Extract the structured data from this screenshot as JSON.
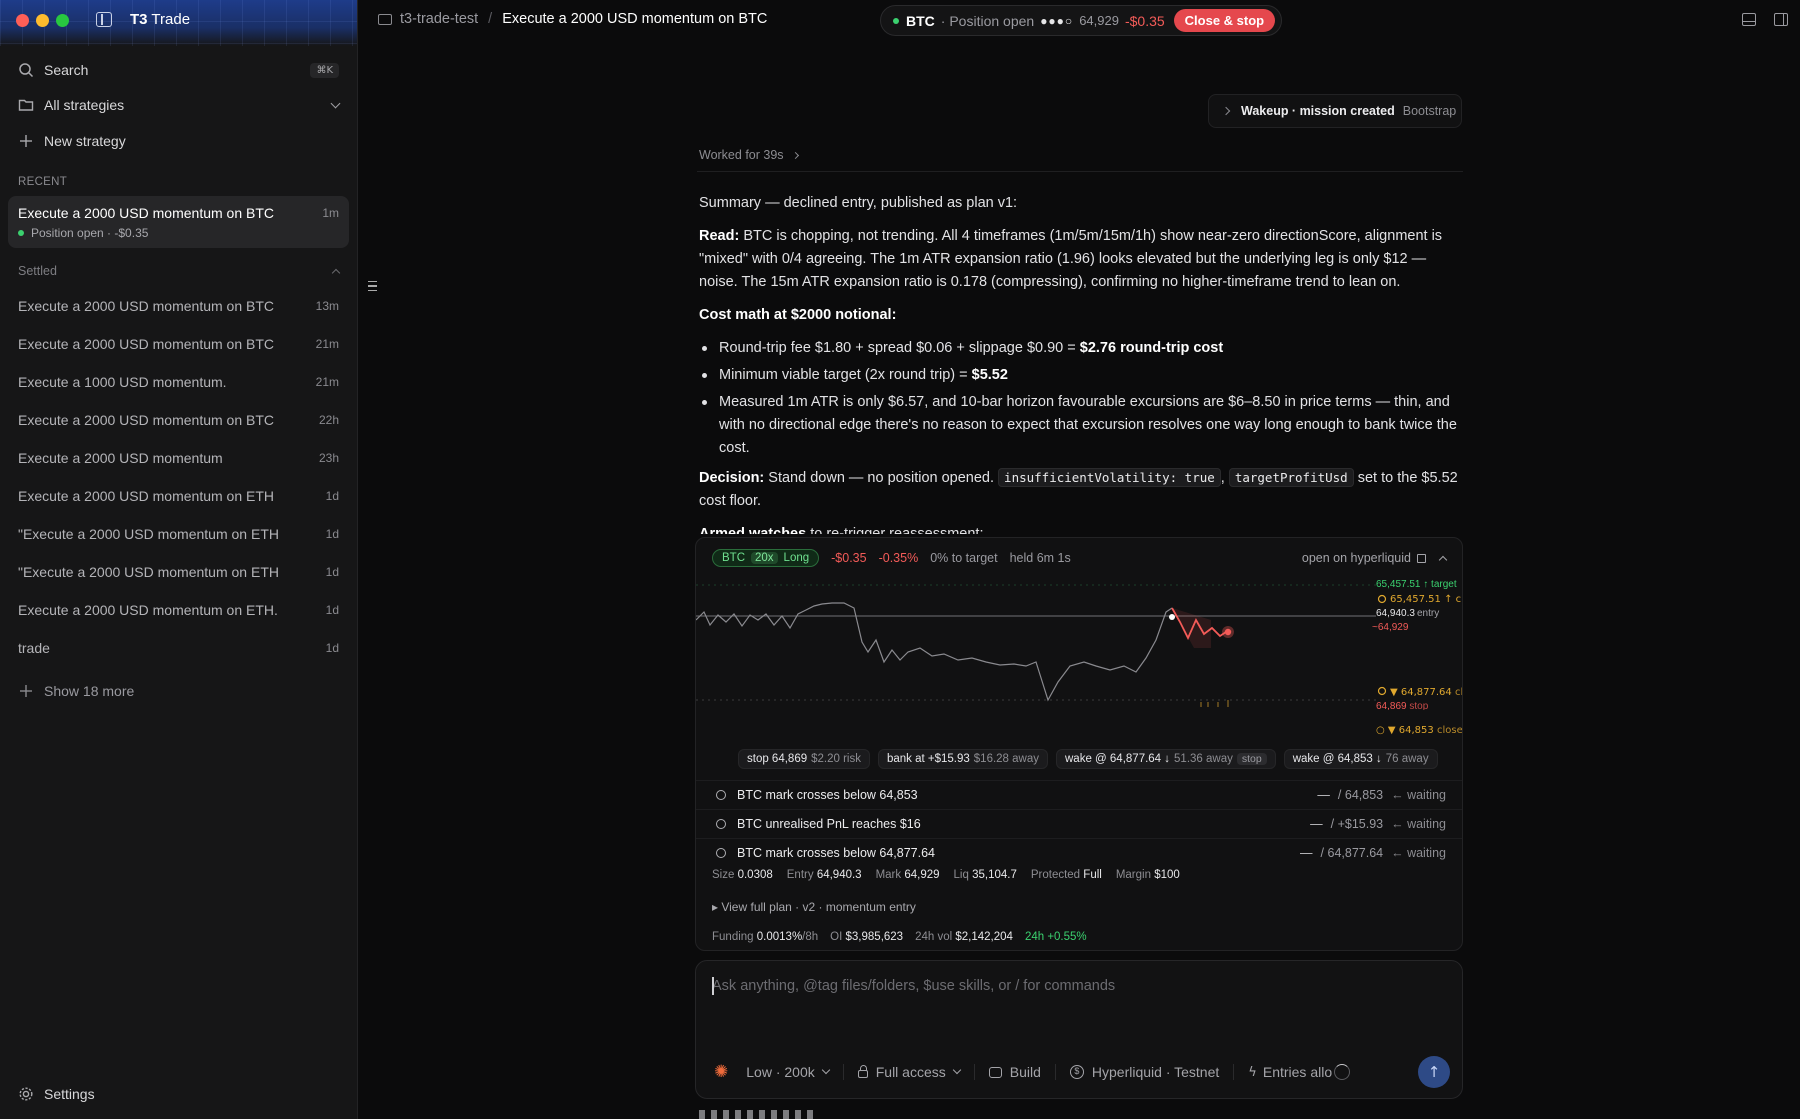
{
  "app": {
    "title_bold": "T3",
    "title_rest": " Trade"
  },
  "sidebar": {
    "search_label": "Search",
    "search_shortcut": "⌘K",
    "strategies_label": "All strategies",
    "new_strategy_label": "New strategy",
    "recent_label": "RECENT",
    "active": {
      "title": "Execute a 2000 USD momentum on BTC",
      "time": "1m",
      "status": "Position open · -$0.35"
    },
    "settled_label": "Settled",
    "settled_items": [
      {
        "title": "Execute a 2000 USD momentum on BTC",
        "time": "13m"
      },
      {
        "title": "Execute a 2000 USD momentum on BTC",
        "time": "21m"
      },
      {
        "title": "Execute a 1000 USD momentum.",
        "time": "21m"
      },
      {
        "title": "Execute a 2000 USD momentum on BTC",
        "time": "22h"
      },
      {
        "title": "Execute a 2000 USD momentum",
        "time": "23h"
      },
      {
        "title": "Execute a 2000 USD momentum on ETH",
        "time": "1d"
      },
      {
        "title": "\"Execute a 2000 USD momentum on ETH",
        "time": "1d"
      },
      {
        "title": "\"Execute a 2000 USD momentum on ETH",
        "time": "1d"
      },
      {
        "title": "Execute a 2000 USD momentum on ETH.",
        "time": "1d"
      },
      {
        "title": "trade",
        "time": "1d"
      }
    ],
    "show_more_label": "Show 18 more",
    "settings_label": "Settings"
  },
  "topbar": {
    "crumb_project": "t3-trade-test",
    "crumb_sep": "/",
    "crumb_title": "Execute a 2000 USD momentum on BTC",
    "pill_symbol": "BTC",
    "pill_status": "· Position open",
    "pill_dots": "●●●○",
    "pill_price": "64,929",
    "pill_pnl": "-$0.35",
    "close_stop_label": "Close & stop"
  },
  "wake_chip": {
    "title": "Wakeup · mission created",
    "tag": "Bootstrap"
  },
  "worked_label": "Worked for 39s",
  "message": {
    "summary": "Summary — declined entry, published as plan v1:",
    "read_label": "Read:",
    "read_text": " BTC is chopping, not trending. All 4 timeframes (1m/5m/15m/1h) show near-zero directionScore, alignment is \"mixed\" with 0/4 agreeing. The 1m ATR expansion ratio (1.96) looks elevated but the underlying leg is only $12 — noise. The 15m ATR expansion ratio is 0.178 (compressing), confirming no higher-timeframe trend to lean on.",
    "cost_heading": "Cost math at $2000 notional:",
    "b1_text": "Round-trip fee $1.80 + spread $0.06 + slippage $0.90 = ",
    "b1_bold": "$2.76 round-trip cost",
    "b2_text": "Minimum viable target (2x round trip) = ",
    "b2_bold": "$5.52",
    "b3_text": "Measured 1m ATR is only $6.57, and 10-bar horizon favourable excursions are $6–8.50 in price terms — thin, and with no directional edge there's no reason to expect that excursion resolves one way long enough to bank twice the cost.",
    "decision_label": "Decision:",
    "decision_text": " Stand down — no position opened. ",
    "code1": "insufficientVolatility: true",
    "comma": ", ",
    "code2": "targetProfitUsd",
    "decision_tail": " set to the $5.52 cost floor.",
    "armed_label": "Armed watches",
    "armed_text": " to re-trigger reassessment:"
  },
  "card": {
    "badge_sym": "BTC",
    "badge_lev": "20x",
    "badge_side": "Long",
    "pnl_usd": "-$0.35",
    "pnl_pct": "-0.35%",
    "to_target": "0% to target",
    "held": "held 6m 1s",
    "open_link": "open on hyperliquid",
    "chart_levels": {
      "target_top": "65,457.51 ↑ target",
      "target_watch": "65,457.51 ↑ c",
      "entry": "64,940.3",
      "entry_word": "entry",
      "mark": "64,929",
      "watch1": "64,877.64",
      "watch1_word": "clo",
      "stop": "64,869",
      "stop_word": "stop",
      "watch2": "64,853",
      "watch2_word": "close."
    },
    "chips": [
      {
        "main": "stop 64,869",
        "muted": "$2.20 risk",
        "tag": ""
      },
      {
        "main": "bank at +$15.93",
        "muted": "$16.28 away",
        "tag": ""
      },
      {
        "main": "wake @ 64,877.64 ↓",
        "muted": "51.36 away",
        "tag": "stop"
      },
      {
        "main": "wake @ 64,853 ↓",
        "muted": "76 away",
        "tag": ""
      }
    ],
    "watches": [
      {
        "label": "BTC mark crosses below 64,853",
        "dash": "—",
        "target": "/ 64,853",
        "state": "← waiting"
      },
      {
        "label": "BTC unrealised PnL reaches $16",
        "dash": "—",
        "target": "/ +$15.93",
        "state": "← waiting"
      },
      {
        "label": "BTC mark crosses below 64,877.64",
        "dash": "—",
        "target": "/ 64,877.64",
        "state": "← waiting"
      }
    ],
    "stats": {
      "size_l": "Size",
      "size": "0.0308",
      "entry_l": "Entry",
      "entry": "64,940.3",
      "mark_l": "Mark",
      "mark": "64,929",
      "liq_l": "Liq",
      "liq": "35,104.7",
      "prot_l": "Protected",
      "prot": "Full",
      "margin_l": "Margin",
      "margin": "$100"
    },
    "plan_label": "▸ View full plan · v2 · momentum entry",
    "funding": {
      "f_l": "Funding",
      "f": "0.0013%",
      "f_u": "/8h",
      "oi_l": "OI",
      "oi": "$3,985,623",
      "vol_l": "24h vol",
      "vol": "$2,142,204",
      "chg": "24h +0.55%"
    }
  },
  "composer": {
    "placeholder": "Ask anything, @tag files/folders, $use skills, or / for commands",
    "model": "Low · 200k",
    "access": "Full access",
    "mode": "Build",
    "venue": "Hyperliquid · Testnet",
    "entries": "Entries allo"
  },
  "colors": {
    "accent": "#2e4a86",
    "positive": "#3bd16f",
    "negative": "#f35b58",
    "warning": "#e0a82e",
    "close_stop": "#e5484d"
  }
}
